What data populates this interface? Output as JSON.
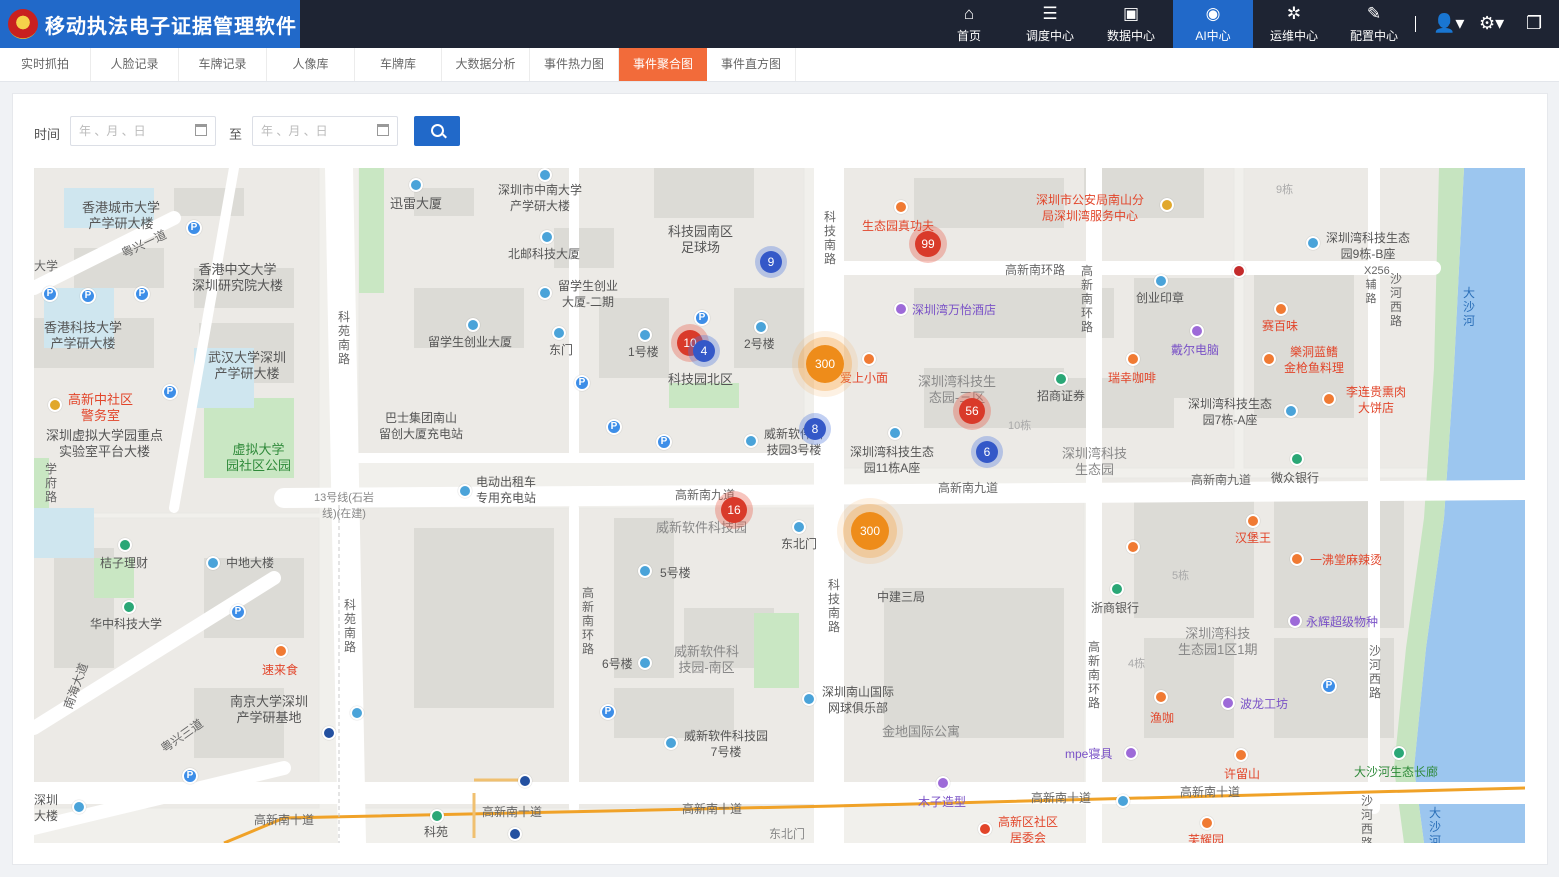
{
  "app": {
    "title": "移动执法电子证据管理软件",
    "emblem": "公安"
  },
  "nav": [
    {
      "label": "首页",
      "icon": "home-icon",
      "glyph": "⌂"
    },
    {
      "label": "调度中心",
      "icon": "dispatch-icon",
      "glyph": "☰"
    },
    {
      "label": "数据中心",
      "icon": "data-icon",
      "glyph": "▣"
    },
    {
      "label": "AI中心",
      "icon": "ai-icon",
      "glyph": "◉"
    },
    {
      "label": "运维中心",
      "icon": "ops-icon",
      "glyph": "✲"
    },
    {
      "label": "配置中心",
      "icon": "config-icon",
      "glyph": "✎"
    }
  ],
  "tabs": [
    {
      "label": "实时抓拍"
    },
    {
      "label": "人脸记录"
    },
    {
      "label": "车牌记录"
    },
    {
      "label": "人像库"
    },
    {
      "label": "车牌库"
    },
    {
      "label": "大数据分析"
    },
    {
      "label": "事件热力图"
    },
    {
      "label": "事件聚合图",
      "active": true
    },
    {
      "label": "事件直方图"
    }
  ],
  "filter": {
    "time_label": "时间",
    "to_label": "至",
    "start_placeholder": "年 、月 、日",
    "end_placeholder": "年 、月 、日"
  },
  "colors": {
    "brand": "#2169c9",
    "topbar": "#1e2433",
    "active_tab": "#f26b3a",
    "cluster_blue": "#3458c8",
    "cluster_red": "#d93a2a",
    "cluster_orange": "#ee8c1a"
  },
  "clusters": [
    {
      "count": "9",
      "level": "blue"
    },
    {
      "count": "99",
      "level": "red"
    },
    {
      "count": "10",
      "level": "red"
    },
    {
      "count": "4",
      "level": "blue"
    },
    {
      "count": "300",
      "level": "orange"
    },
    {
      "count": "56",
      "level": "red"
    },
    {
      "count": "8",
      "level": "blue"
    },
    {
      "count": "6",
      "level": "blue"
    },
    {
      "count": "16",
      "level": "red"
    },
    {
      "count": "300",
      "level": "orange"
    }
  ],
  "map": {
    "labels": {
      "hkcu": "香港城市大学\n产学研大楼",
      "cuhk": "香港中文大学\n深圳研究院大楼",
      "hkust": "香港科技大学\n产学研大楼",
      "whu": "武汉大学深圳\n产学研大楼",
      "police": "高新中社区\n警务室",
      "virtual_lab": "深圳虚拟大学园重点\n实验室平台大楼",
      "virtual_park": "虚拟大学\n园社区公园",
      "xunlei": "迅雷大厦",
      "csu": "深圳市中南大学\n产学研大楼",
      "bupt": "北邮科技大厦",
      "stadium": "科技园南区\n足球场",
      "liuxue2": "留学生创业\n大厦-二期",
      "liuxue": "留学生创业大厦",
      "dongmen": "东门",
      "bld1": "1号楼",
      "bld2": "2号楼",
      "north_zone": "科技园北区",
      "bashi": "巴士集团南山\n留创大厦充电站",
      "weixin3": "威新软件科\n技园3号楼",
      "taxi": "电动出租车\n专用充电站",
      "line13": "13号线(石岩\n线)(在建)",
      "weixin_park": "威新软件科技园",
      "dongbeimen": "东北门",
      "bld5": "5号楼",
      "bld6": "6号楼",
      "weixin_south": "威新软件科\n技园-南区",
      "weixin7": "威新软件科技园\n7号楼",
      "zhongjian": "中建三局",
      "tennis": "深圳南山国际\n网球俱乐部",
      "jindi": "金地国际公寓",
      "jiezi": "桔子理财",
      "zhongdi": "中地大楼",
      "hust": "华中科技大学",
      "sulaishi": "速来食",
      "nju": "南京大学深圳\n产学研基地",
      "shenzhen_big": "深圳\n大楼",
      "police_bureau": "深圳市公安局南山分\n局深圳湾服务中心",
      "gongfu": "生态园真功夫",
      "wanyi": "深圳湾万怡酒店",
      "aishang": "爱上小面",
      "eco_park3": "深圳湾科技生\n态园-三区",
      "eco_11a": "深圳湾科技生态\n园11栋A座",
      "zhaoshang": "招商证券",
      "eco_park": "深圳湾科技\n生态园",
      "chuangye": "创业印章",
      "dell": "戴尔电脑",
      "ruixing": "瑞幸咖啡",
      "saibaiwei": "赛百味",
      "eco_9b": "深圳湾科技生态\n园9栋-B座",
      "yuedong": "樂洞蓝鳍\n金枪鱼料理",
      "eco_7a": "深圳湾科技生态\n园7栋-A座",
      "lilian": "李连贵熏肉\n大饼店",
      "weizhong": "微众银行",
      "hanbao": "汉堡王",
      "yifutang": "一沸堂麻辣烫",
      "zheshang": "浙商银行",
      "yonghui": "永辉超级物种",
      "eco_1": "深圳湾科技\n生态园1区1期",
      "yuka": "渔咖",
      "bolong": "波龙工坊",
      "mpe": "mpe寝具",
      "xuliushan": "许留山",
      "dashahe_corridor": "大沙河生态长廊",
      "muzi": "木子造型",
      "gaoxin_committee": "高新区社区\n居委会",
      "kekan": "科苑",
      "dongbeimen2": "东北门",
      "fuliyuan": "芙耀园"
    },
    "roads": {
      "gaoxin_nanhuan": "高新南环路",
      "gaoxin_nanjiu": "高新南九道",
      "gaoxin_nanjiu2": "高新南九道",
      "gaoxin_nanjiu3": "高新南九道",
      "gaoxin_nanshi": "高新南十道",
      "gaoxin_nanshi2": "高新南十道",
      "gaoxin_nanshi3": "高新南十道",
      "gaoxin_nanshi4": "高新南十道",
      "gaoxin_nanshi5": "高新南十道",
      "yuexing1": "粤兴一道",
      "yuexing3": "粤兴三道",
      "keji_nan": "科技南路",
      "keji_nan2": "科技南路",
      "keyuan_nan": "科苑南路",
      "keyuan_nan2": "科苑南路",
      "gaoxin_huan": "高新南环路",
      "gaoxin_huan2": "高新南环路",
      "gaoxin_huan3": "高新南环路",
      "shahe_west": "沙河西路",
      "shahe_west2": "沙河西路",
      "shahe_west3": "沙河西路",
      "x256": "X256辅路",
      "dashahe": "大沙河",
      "dashahe2": "大沙河",
      "nanyu": "南海大道",
      "xuefu": "学府路",
      "daxue": "大学",
      "building9": "9栋",
      "building10": "10栋",
      "building5": "5栋",
      "building4": "4栋"
    }
  }
}
